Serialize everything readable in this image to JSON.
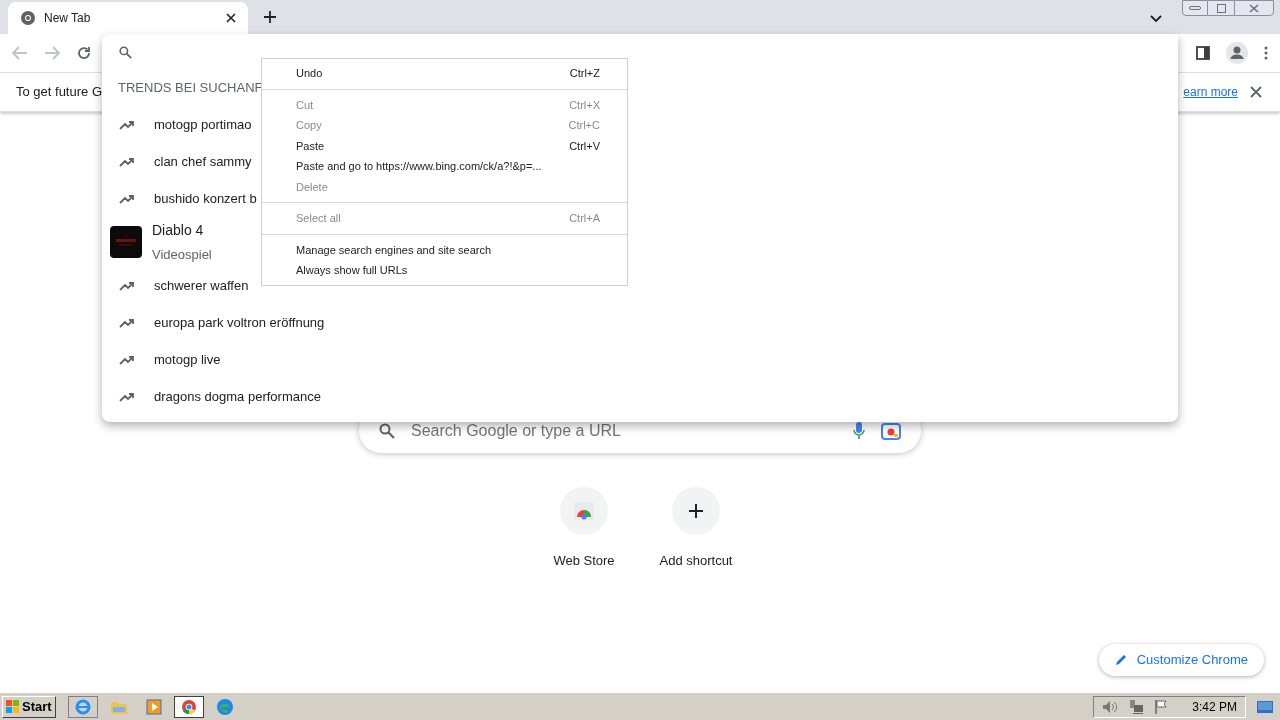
{
  "tab": {
    "title": "New Tab",
    "selected": true
  },
  "infobar": {
    "text": "To get future G",
    "link": "earn more"
  },
  "omnibox_dropdown": {
    "header": "TRENDS BEI SUCHANF",
    "suggestions": [
      {
        "kind": "trend",
        "text": "motogp portimao"
      },
      {
        "kind": "trend",
        "text": "clan chef sammy"
      },
      {
        "kind": "trend",
        "text": "bushido konzert b"
      },
      {
        "kind": "entity",
        "text": "Diablo 4",
        "subtitle": "Videospiel"
      },
      {
        "kind": "trend",
        "text": "schwerer waffen"
      },
      {
        "kind": "trend",
        "text": "europa park voltron eröffnung"
      },
      {
        "kind": "trend",
        "text": "motogp live"
      },
      {
        "kind": "trend",
        "text": "dragons dogma performance"
      }
    ]
  },
  "context_menu": [
    {
      "kind": "item",
      "label": "Undo",
      "shortcut": "Ctrl+Z",
      "disabled": false
    },
    {
      "kind": "separator"
    },
    {
      "kind": "item",
      "label": "Cut",
      "shortcut": "Ctrl+X",
      "disabled": true
    },
    {
      "kind": "item",
      "label": "Copy",
      "shortcut": "Ctrl+C",
      "disabled": true
    },
    {
      "kind": "item",
      "label": "Paste",
      "shortcut": "Ctrl+V",
      "disabled": false
    },
    {
      "kind": "item",
      "label": "Paste and go to https://www.bing.com/ck/a?!&p=...",
      "disabled": false
    },
    {
      "kind": "item",
      "label": "Delete",
      "disabled": true
    },
    {
      "kind": "separator"
    },
    {
      "kind": "item",
      "label": "Select all",
      "shortcut": "Ctrl+A",
      "disabled": true
    },
    {
      "kind": "separator"
    },
    {
      "kind": "item",
      "label": "Manage search engines and site search",
      "disabled": false
    },
    {
      "kind": "item",
      "label": "Always show full URLs",
      "disabled": false
    }
  ],
  "new_tab_page": {
    "search_placeholder": "Search Google or type a URL",
    "shortcuts": [
      {
        "kind": "store",
        "label": "Web Store"
      },
      {
        "kind": "add",
        "label": "Add shortcut"
      }
    ],
    "customize_button": "Customize Chrome"
  },
  "taskbar": {
    "start": "Start",
    "clock": "3:42 PM"
  }
}
